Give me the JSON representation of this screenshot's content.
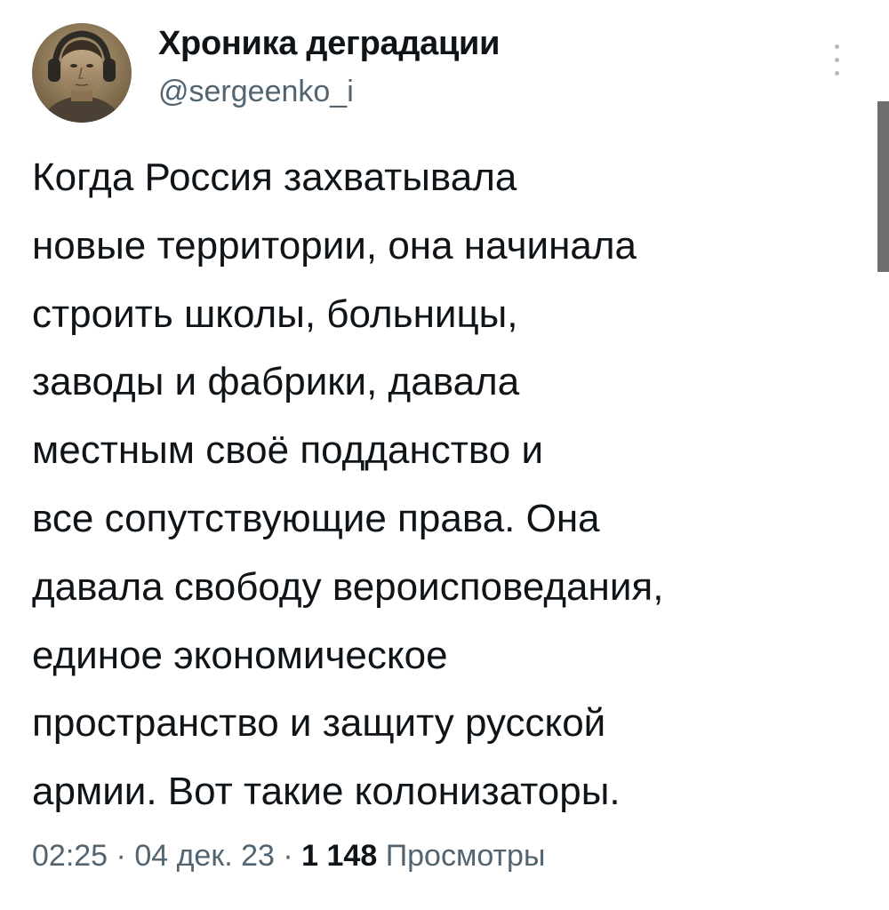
{
  "author": {
    "display_name": "Хроника деградации",
    "handle": "@sergeenko_i"
  },
  "icons": {
    "avatar": "profile-photo",
    "more": "vertical-ellipsis-icon"
  },
  "tweet": {
    "lines": [
      "Когда Россия захватывала",
      "новые территории, она начинала",
      "строить школы, больницы,",
      "заводы и фабрики, давала",
      "местным своё подданство и",
      "все сопутствующие права. Она",
      "давала свободу вероисповедания,",
      "единое экономическое",
      "пространство и защиту русской",
      "армии. Вот такие колонизаторы."
    ]
  },
  "meta": {
    "time": "02:25",
    "separator_1": " · ",
    "date": "04 дек. 23",
    "separator_2": " · ",
    "views_count": "1 148",
    "views_label": "Просмотры"
  },
  "colors": {
    "text_primary": "#0f1419",
    "text_secondary": "#536471",
    "background": "#ffffff",
    "scrollbar": "#6f6f6f"
  }
}
